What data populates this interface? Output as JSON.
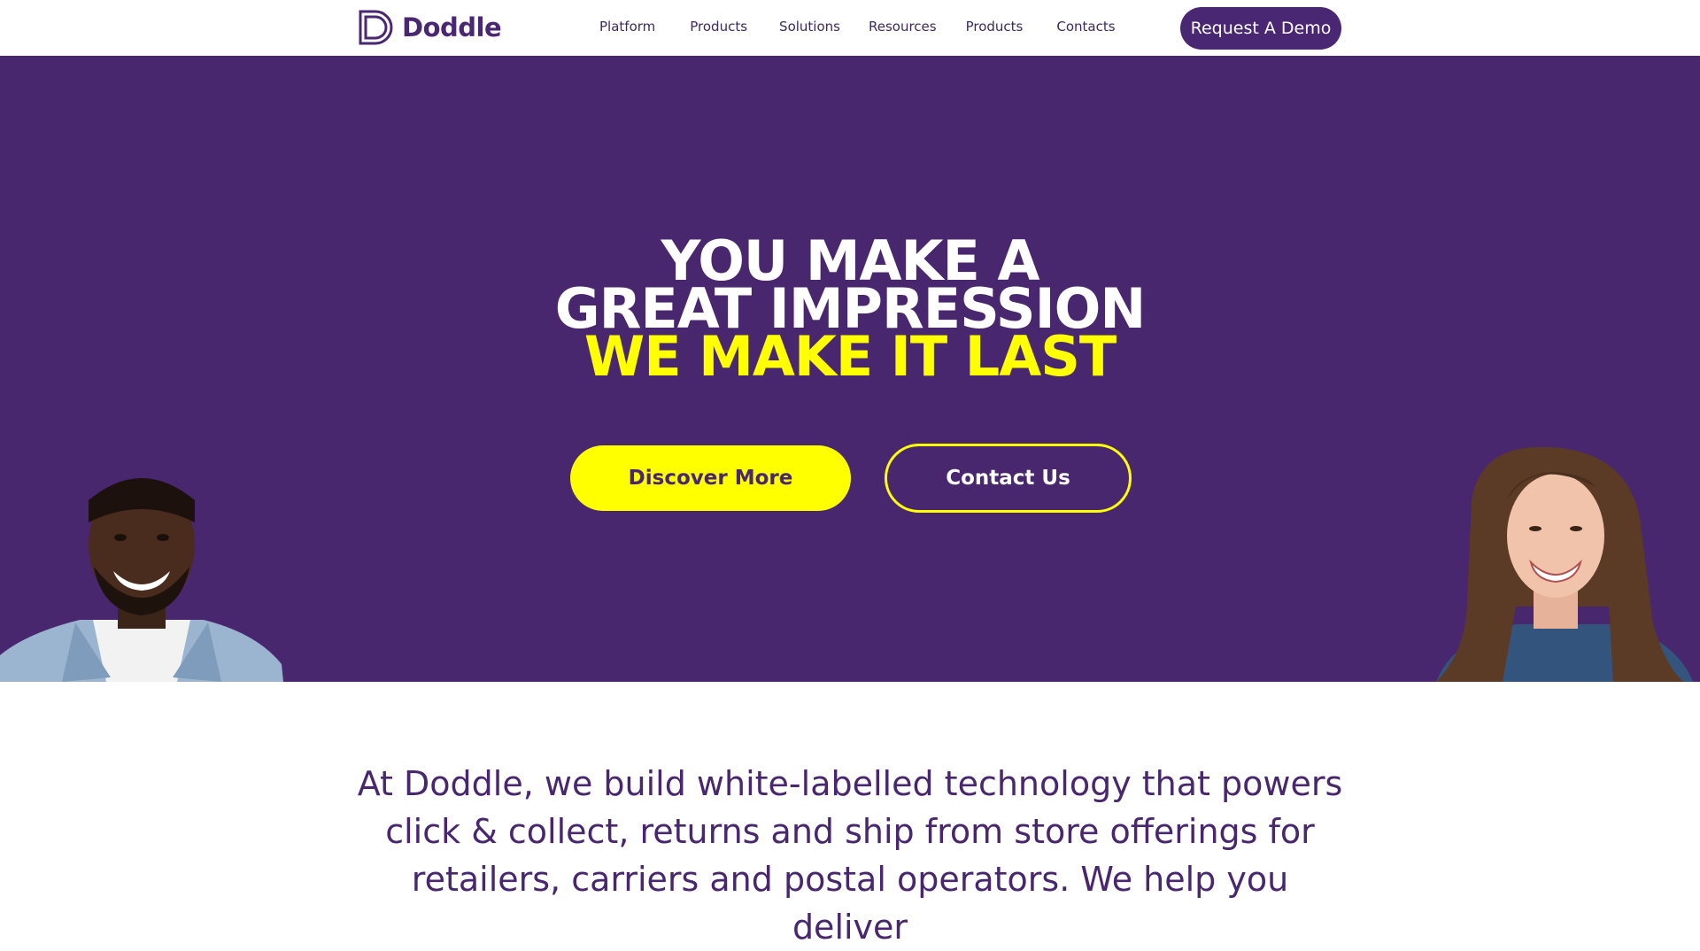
{
  "header": {
    "logo_text": "Doddle",
    "nav": [
      "Platform",
      "Products",
      "Solutions",
      "Resources",
      "Products",
      "Contacts"
    ],
    "demo_label": "Request A Demo"
  },
  "hero": {
    "title_line1": "YOU MAKE A",
    "title_line2": "GREAT IMPRESSION",
    "title_line3": "WE MAKE IT LAST",
    "discover_label": "Discover More",
    "contact_label": "Contact Us",
    "background": "#48276e",
    "accent": "#ffff00"
  },
  "intro": {
    "text": "At Doddle, we build white-labelled technology that powers click & collect, returns and ship from store offerings for retailers, carriers and postal operators. We help you deliver"
  }
}
